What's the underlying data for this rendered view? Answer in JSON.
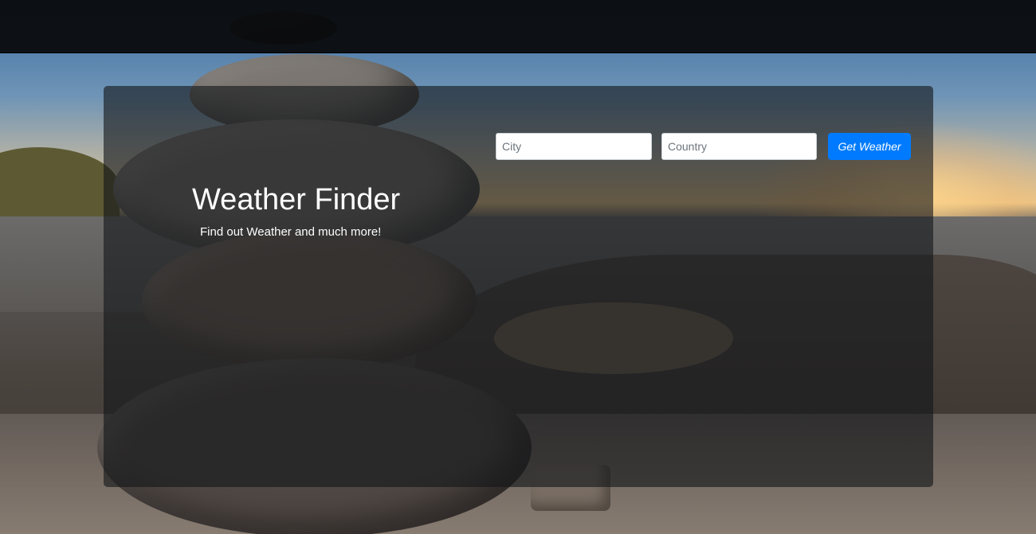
{
  "header": {
    "title": "Weather Finder",
    "subtitle": "Find out Weather and much more!"
  },
  "form": {
    "city_placeholder": "City",
    "country_placeholder": "Country",
    "city_value": "",
    "country_value": "",
    "submit_label": "Get Weather"
  },
  "colors": {
    "navbar": "#0a0b0e",
    "button": "#007bff",
    "text": "#ffffff"
  }
}
